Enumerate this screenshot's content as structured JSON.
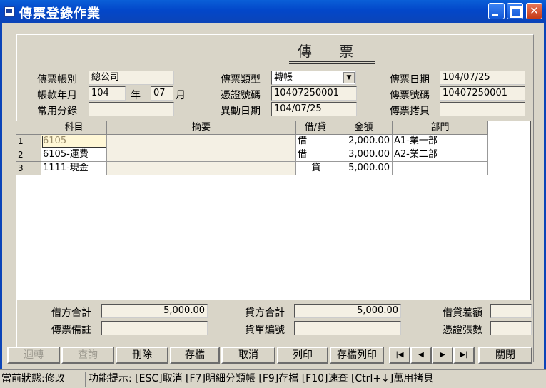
{
  "window": {
    "title": "傳票登錄作業"
  },
  "heading": "傳 票",
  "header": {
    "account_book_label": "傳票帳別",
    "account_book_value": "總公司",
    "voucher_type_label": "傳票類型",
    "voucher_type_value": "轉帳",
    "voucher_date_label": "傳票日期",
    "voucher_date_value": "104/07/25",
    "period_label": "帳款年月",
    "period_year": "104",
    "year_unit": "年",
    "period_month": "07",
    "month_unit": "月",
    "certificate_no_label": "憑證號碼",
    "certificate_no_value": "10407250001",
    "voucher_no_label": "傳票號碼",
    "voucher_no_value": "10407250001",
    "common_entry_label": "常用分錄",
    "common_entry_value": "",
    "change_date_label": "異動日期",
    "change_date_value": "104/07/25",
    "voucher_copier_label": "傳票拷貝",
    "voucher_copier_value": ""
  },
  "grid": {
    "columns": [
      "科目",
      "摘要",
      "借/貸",
      "金額",
      "部門"
    ],
    "rows": [
      {
        "no": "1",
        "account": "6105",
        "memo": "",
        "dc": "借",
        "amount": "2,000.00",
        "dept": "A1-業一部"
      },
      {
        "no": "2",
        "account": "6105-運費",
        "memo": "",
        "dc": "借",
        "amount": "3,000.00",
        "dept": "A2-業二部"
      },
      {
        "no": "3",
        "account": "1111-現金",
        "memo": "",
        "dc": "貸",
        "amount": "5,000.00",
        "dept": ""
      }
    ]
  },
  "totals": {
    "debit_total_label": "借方合計",
    "debit_total_value": "5,000.00",
    "credit_total_label": "貸方合計",
    "credit_total_value": "5,000.00",
    "diff_label": "借貸差額",
    "diff_value": "",
    "note_label": "傳票備註",
    "note_value": "",
    "credit_slip_label": "貨單編號",
    "credit_slip_value": "",
    "cert_count_label": "憑證張數",
    "cert_count_value": ""
  },
  "toolbar": {
    "reverse": "迴轉",
    "query": "查詢",
    "delete": "刪除",
    "save": "存檔",
    "cancel": "取消",
    "print": "列印",
    "save_print": "存檔列印",
    "close": "關閉"
  },
  "status": {
    "state": "當前狀態:修改",
    "hint": "功能提示: [ESC]取消 [F7]明細分類帳 [F9]存檔 [F10]速查 [Ctrl+↓]萬用拷貝"
  }
}
